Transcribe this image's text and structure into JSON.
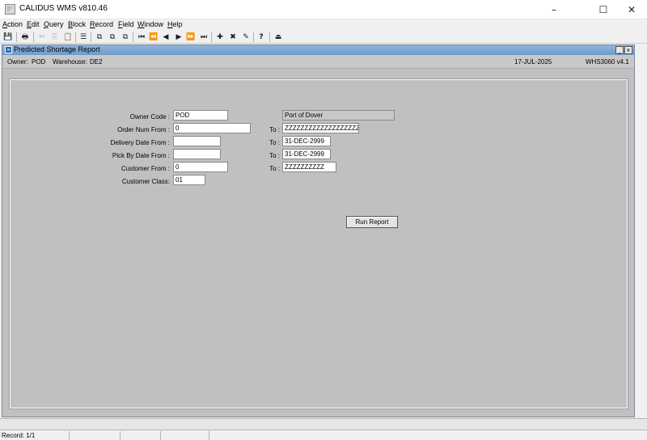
{
  "window": {
    "title": "CALIDUS WMS v810.46"
  },
  "menu": [
    {
      "label_u": "A",
      "label_rest": "ction"
    },
    {
      "label_u": "E",
      "label_rest": "dit"
    },
    {
      "label_u": "Q",
      "label_rest": "uery"
    },
    {
      "label_u": "B",
      "label_rest": "lock"
    },
    {
      "label_u": "R",
      "label_rest": "ecord"
    },
    {
      "label_u": "F",
      "label_rest": "ield"
    },
    {
      "label_u": "W",
      "label_rest": "indow"
    },
    {
      "label_u": "H",
      "label_rest": "elp"
    }
  ],
  "toolbar": {
    "save": "💾",
    "print": "🖶",
    "cut": "✂",
    "copy": "⎘",
    "paste": "📋",
    "clear": "☰",
    "enter_query": "⧉",
    "exec_query": "⧉",
    "count_query": "⧉",
    "first": "⏮",
    "prev_block": "⏪",
    "prev": "◀",
    "next": "▶",
    "next_block": "⏩",
    "last": "⏭",
    "insert": "✚",
    "delete": "✖",
    "clear_record": "✎",
    "help": "?",
    "exit": "⏏"
  },
  "form": {
    "title": "Predicted Shortage Report",
    "owner_label": "Owner:",
    "owner_value": "POD",
    "warehouse_label": "Warehouse:",
    "warehouse_value": "DE2",
    "date": "17-JUL-2025",
    "module": "WHS3060  v4.1"
  },
  "fields": {
    "owner_code_label": "Owner Code :",
    "owner_code": "POD",
    "owner_name": "Port of Dover",
    "order_num_from_label": "Order Num From :",
    "order_num_from": "0",
    "order_num_to": "ZZZZZZZZZZZZZZZZZZZZ",
    "delivery_date_from_label": "Delivery Date From :",
    "delivery_date_from": "",
    "delivery_date_to": "31-DEC-2999",
    "pick_by_date_from_label": "Pick By Date From :",
    "pick_by_date_from": "",
    "pick_by_date_to": "31-DEC-2999",
    "customer_from_label": "Customer From :",
    "customer_from": "0",
    "customer_to": "ZZZZZZZZZZ",
    "customer_class_label": "Customer Class:",
    "customer_class": "01",
    "to_label": "To :"
  },
  "buttons": {
    "run_report": "Run Report"
  },
  "status": {
    "record": "Record: 1/1"
  }
}
